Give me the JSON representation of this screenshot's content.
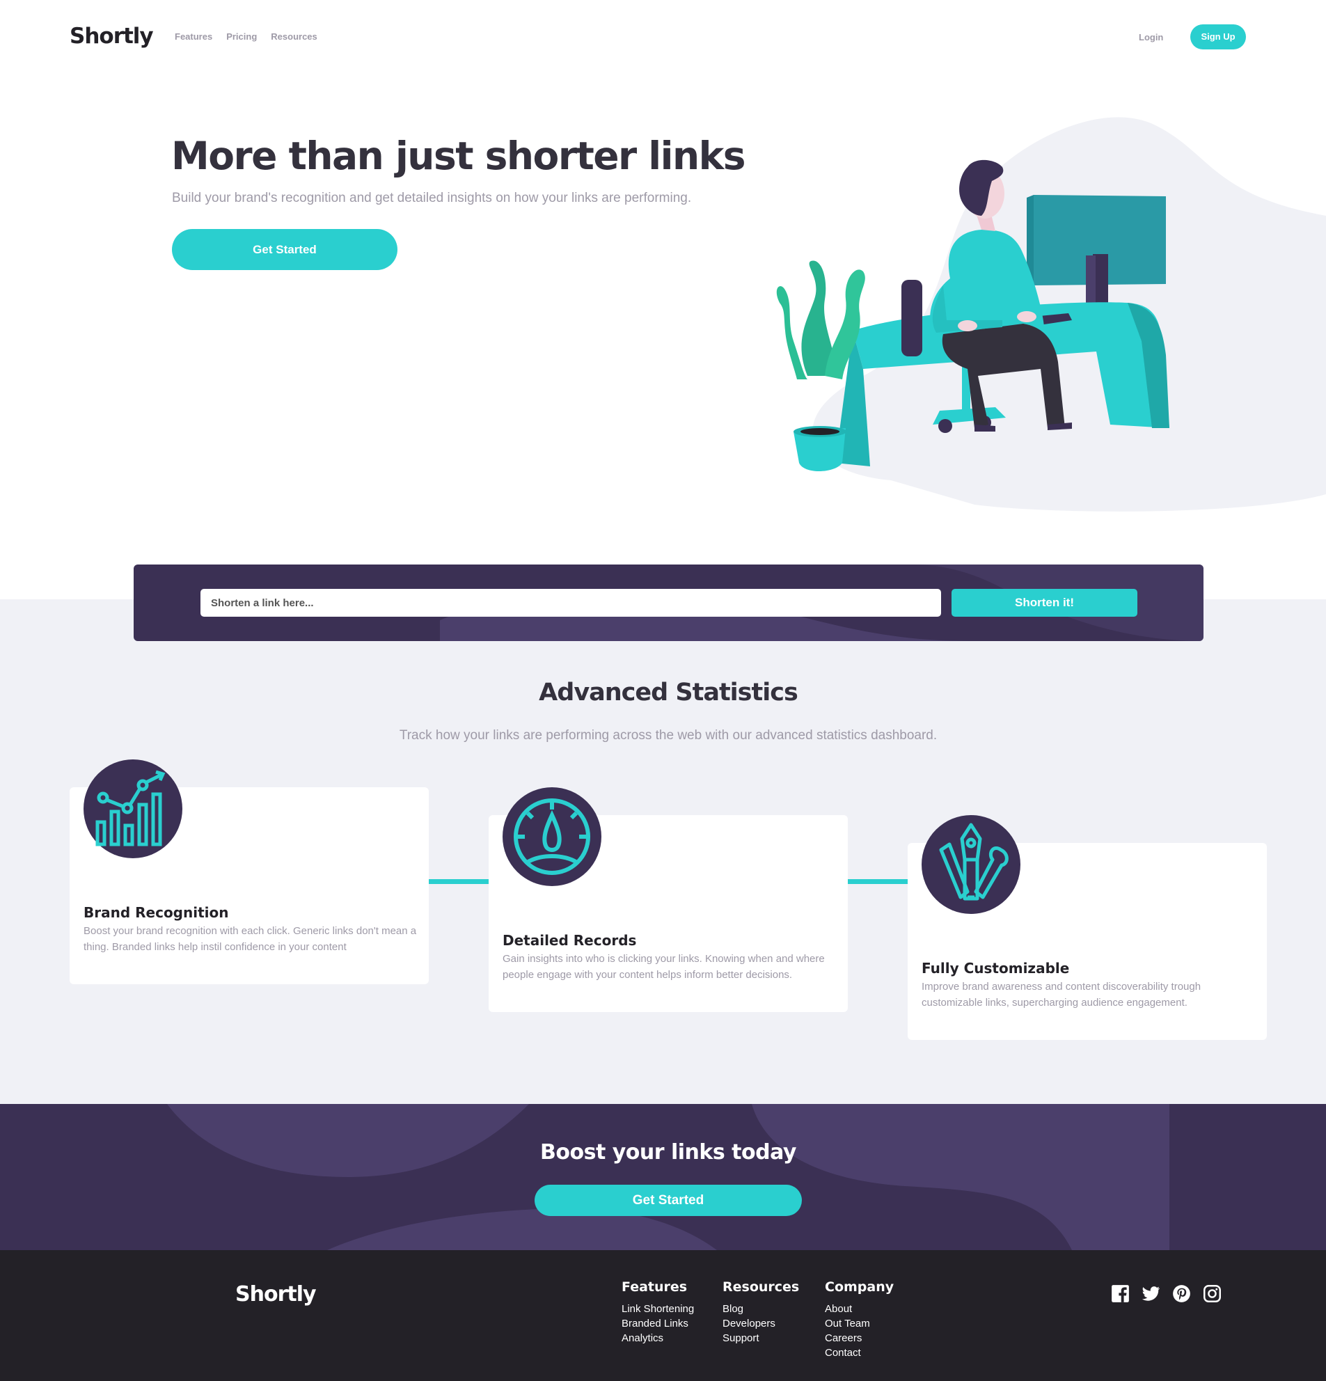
{
  "header": {
    "logo": "Shortly",
    "nav": [
      "Features",
      "Pricing",
      "Resources"
    ],
    "login": "Login",
    "signup": "Sign Up"
  },
  "hero": {
    "title": "More than just shorter links",
    "subtitle": "Build your brand's recognition and get detailed insights on how your links are performing.",
    "cta": "Get Started"
  },
  "shorten": {
    "placeholder": "Shorten a link here...",
    "button": "Shorten it!"
  },
  "stats": {
    "title": "Advanced Statistics",
    "subtitle": "Track how your links are performing across the web with our advanced statistics dashboard.",
    "cards": [
      {
        "icon": "chart-icon",
        "title": "Brand Recognition",
        "text": "Boost your brand recognition with each click. Generic links don't mean a thing. Branded links help instil confidence in your content"
      },
      {
        "icon": "gauge-icon",
        "title": "Detailed Records",
        "text": "Gain insights into who is clicking your links. Knowing when and where people engage with your content helps inform better decisions."
      },
      {
        "icon": "tools-icon",
        "title": "Fully Customizable",
        "text": "Improve brand awareness and content discoverability trough customizable links, supercharging audience engagement."
      }
    ]
  },
  "boost": {
    "title": "Boost your links today",
    "cta": "Get Started"
  },
  "footer": {
    "logo": "Shortly",
    "columns": [
      {
        "title": "Features",
        "links": [
          "Link Shortening",
          "Branded Links",
          "Analytics"
        ]
      },
      {
        "title": "Resources",
        "links": [
          "Blog",
          "Developers",
          "Support"
        ]
      },
      {
        "title": "Company",
        "links": [
          "About",
          "Out Team",
          "Careers",
          "Contact"
        ]
      }
    ],
    "socials": [
      "facebook-icon",
      "twitter-icon",
      "pinterest-icon",
      "instagram-icon"
    ]
  },
  "colors": {
    "accent": "#2acfcf",
    "dark_violet": "#3b3054",
    "very_dark": "#232127",
    "gray": "#9e9aa7",
    "light_bg": "#f0f1f6"
  }
}
